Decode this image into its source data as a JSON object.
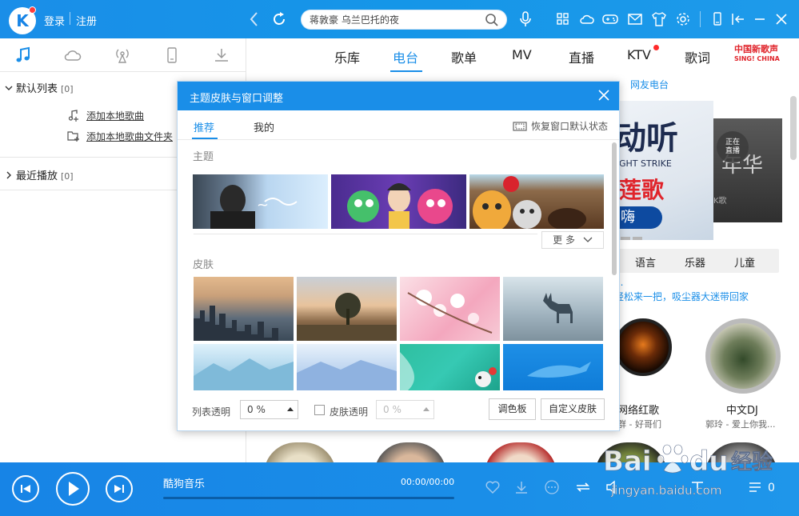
{
  "topbar": {
    "logo": "K",
    "login": "登录",
    "register": "注册",
    "search_value": "蒋敦豪 乌兰巴托的夜"
  },
  "left_panel": {
    "default_list": {
      "label": "默认列表",
      "count": "[0]"
    },
    "add_local_song": "添加本地歌曲",
    "add_local_folder": "添加本地歌曲文件夹",
    "recent": {
      "label": "最近播放",
      "count": "[0]"
    }
  },
  "right_panel": {
    "nav": [
      "乐库",
      "电台",
      "歌单",
      "MV",
      "直播",
      "KTV",
      "歌词"
    ],
    "brand_line1": "中国新歌声",
    "brand_line2": "SING! CHINA",
    "subnav": "网友电台",
    "banner": {
      "t1": "动听",
      "t2": "GHT STRIKE",
      "t3": "莲歌",
      "t4": "嗨"
    },
    "banner2": {
      "t1": "年华",
      "t2": "K歌"
    },
    "live_badge_1": "正在",
    "live_badge_2": "直播",
    "categories": [
      "语言",
      "乐器",
      "儿童"
    ],
    "promo_1": "...",
    "promo_2": "轻松来一把，吸尘器大迷带回家",
    "stations": [
      {
        "label": "网络红歌",
        "sub": "群 - 好哥们"
      },
      {
        "label": "中文DJ",
        "sub": "郭玲 - 爱上你我..."
      }
    ]
  },
  "modal": {
    "title": "主题皮肤与窗口调整",
    "tabs": [
      "推荐",
      "我的"
    ],
    "restore": "恢复窗口默认状态",
    "theme_section": "主题",
    "more": "更 多",
    "skin_section": "皮肤",
    "list_opacity_label": "列表透明",
    "list_opacity_value": "0 %",
    "skin_opacity_label": "皮肤透明",
    "skin_opacity_value": "0 %",
    "palette_button": "调色板",
    "custom_skin_button": "自定义皮肤"
  },
  "player": {
    "title": "酷狗音乐",
    "time": "00:00/00:00",
    "queue_count": "0"
  },
  "watermark": {
    "text": "Bai du 经验",
    "sub": "jingyan.baidu.com"
  },
  "colors": {
    "accent": "#1a8ee8",
    "brand_red": "#e0242b",
    "notify": "#ff3b3b"
  }
}
